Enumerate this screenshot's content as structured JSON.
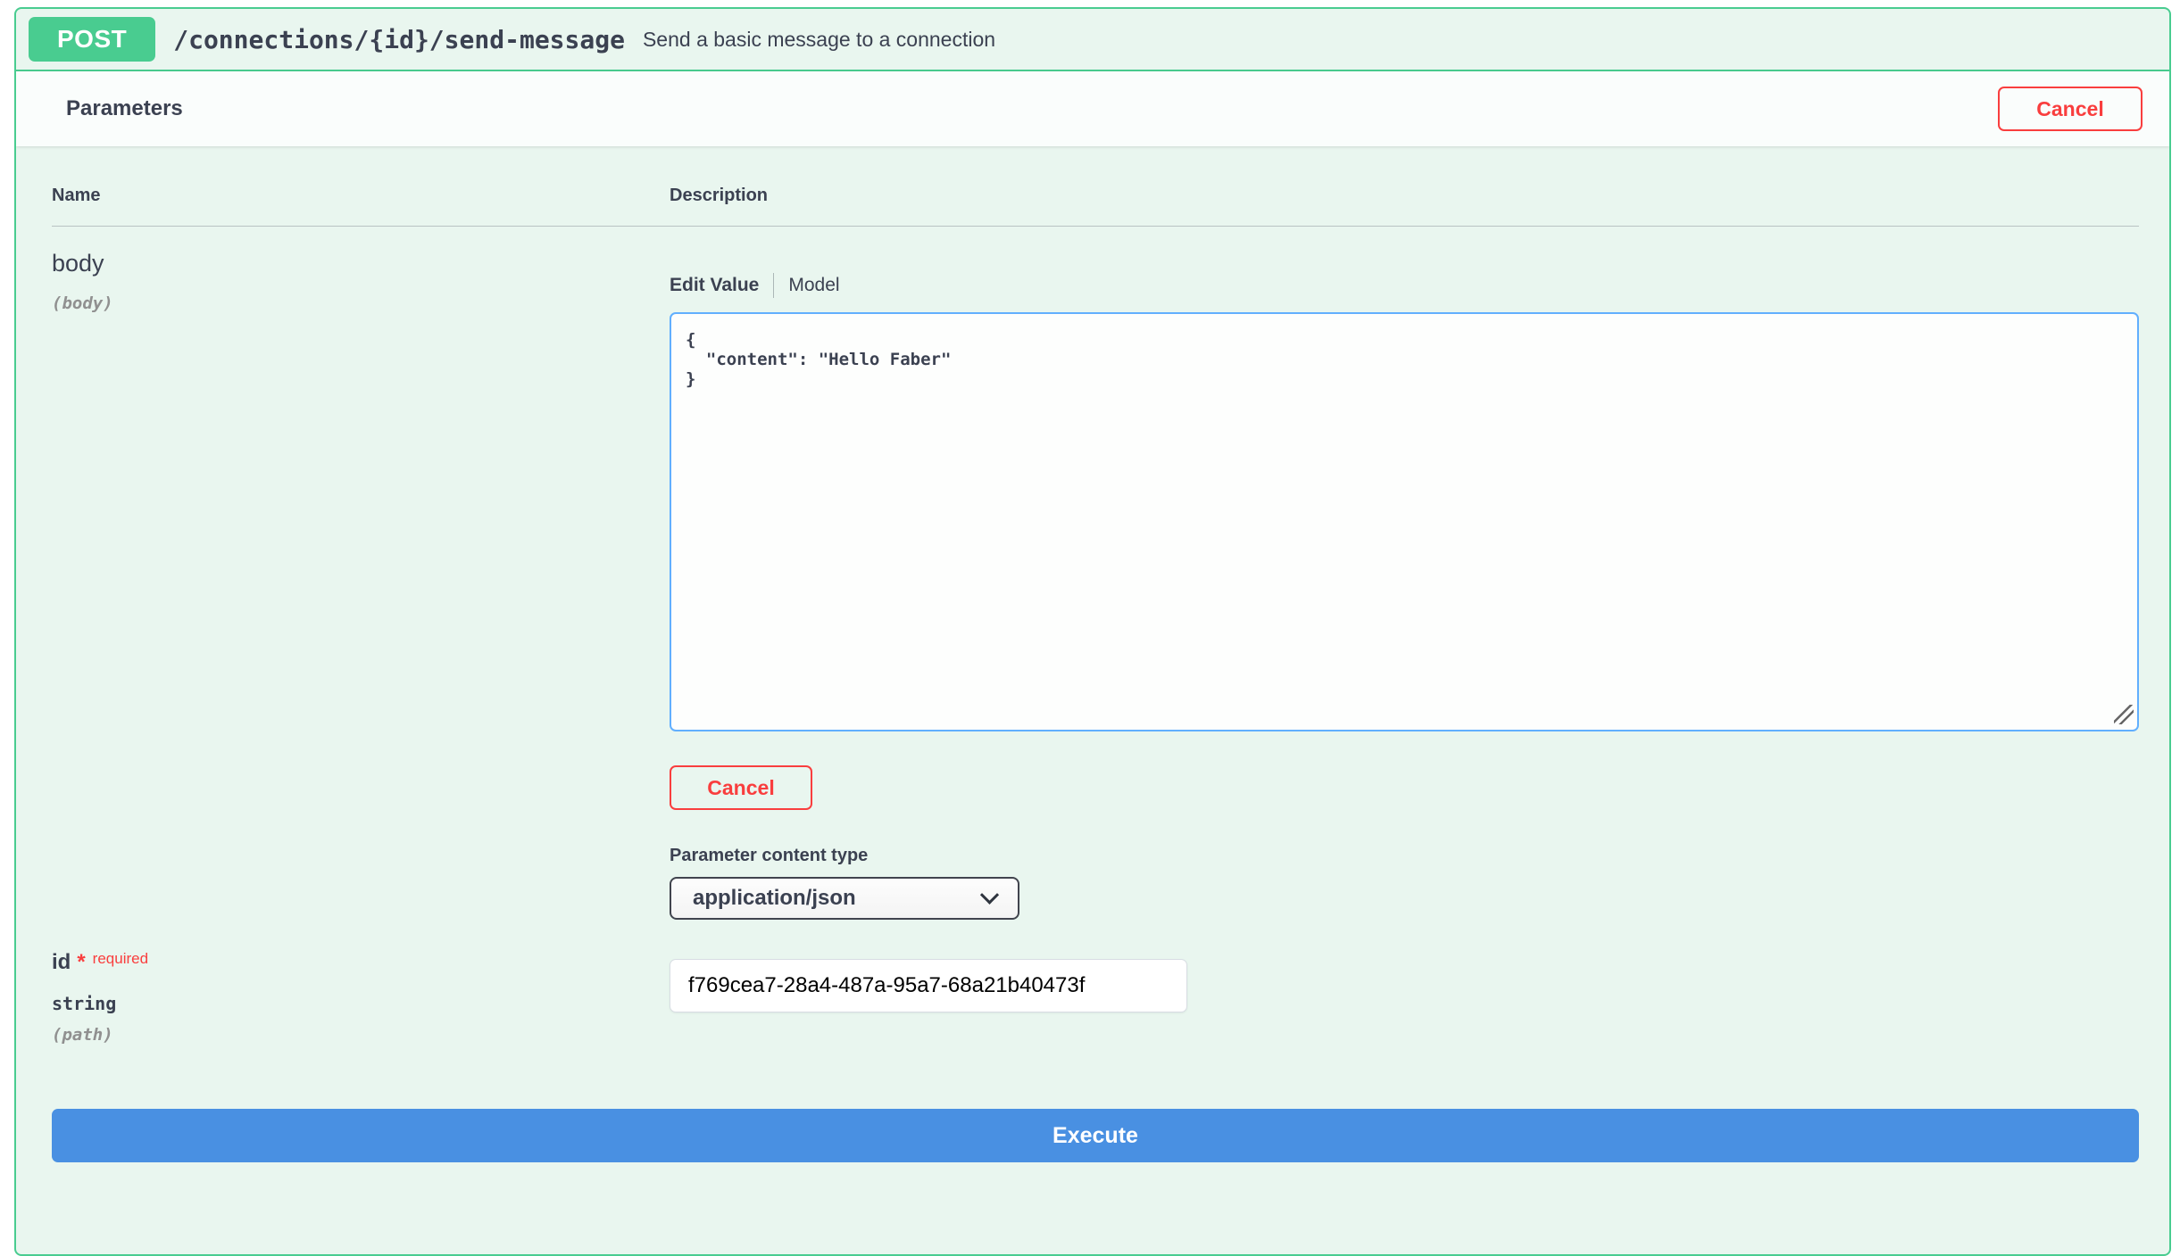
{
  "endpoint": {
    "method": "POST",
    "path": "/connections/{id}/send-message",
    "summary": "Send a basic message to a connection"
  },
  "parameters_section": {
    "title": "Parameters",
    "cancel_button": "Cancel"
  },
  "columns": {
    "name": "Name",
    "description": "Description"
  },
  "body_param": {
    "name": "body",
    "location": "(body)",
    "edit_value_tab": "Edit Value",
    "model_tab": "Model",
    "value": "{\n  \"content\": \"Hello Faber\"\n}",
    "cancel_button": "Cancel",
    "content_type_label": "Parameter content type",
    "content_type": "application/json"
  },
  "id_param": {
    "name": "id",
    "required_marker": "*",
    "required_label": "required",
    "type": "string",
    "location": "(path)",
    "value": "f769cea7-28a4-487a-95a7-68a21b40473f"
  },
  "execute_button": "Execute",
  "colors": {
    "method_green": "#49cc90",
    "panel_background": "#e9f6ef",
    "cancel_red": "#f93e3e",
    "textarea_border_blue": "#61affe",
    "execute_blue": "#4990e2",
    "text_dark": "#3b4151"
  }
}
